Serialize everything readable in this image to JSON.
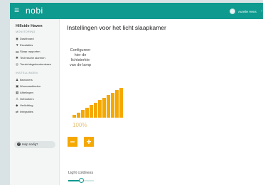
{
  "topbar": {
    "menu_icon": "hamburger-icon",
    "logo": "nobi",
    "user_name": "Aurelie Hens",
    "user_icon": "avatar-icon",
    "caret_icon": "chevron-down-icon",
    "color": "#0f9a8f"
  },
  "sidebar": {
    "org_name": "Hillside Haven",
    "monitoring_title": "MONITORING",
    "monitoring_items": [
      {
        "label": "Dashboard",
        "icon": "dashboard-icon"
      },
      {
        "label": "Escalaties",
        "icon": "alert-icon"
      },
      {
        "label": "Slaap rapporten",
        "icon": "bed-icon"
      },
      {
        "label": "Technische alarmen",
        "icon": "tools-icon"
      },
      {
        "label": "Toezichtsgebeurtenissen",
        "icon": "eye-icon"
      }
    ],
    "settings_title": "INSTELLINGEN",
    "settings_items": [
      {
        "label": "Bewoners",
        "icon": "people-icon"
      },
      {
        "label": "Woonaanbieden",
        "icon": "home-icon"
      },
      {
        "label": "Afdelingen",
        "icon": "grid-icon"
      },
      {
        "label": "Gebruikers",
        "icon": "users-icon"
      },
      {
        "label": "Verlichting",
        "icon": "bulb-icon"
      },
      {
        "label": "Integraties",
        "icon": "plug-icon"
      }
    ],
    "help_label": "Hulp nodig?"
  },
  "main": {
    "title": "Instellingen voor het licht slaapkamer",
    "configure_text": "Configureer hier de lichtsterkte van de lamp",
    "brightness_percent": "100%",
    "brightness_level": 12,
    "brightness_max": 12,
    "decrease_label": "−",
    "increase_label": "+",
    "accent_color": "#f5a800",
    "light_coldness_label": "Light coldness",
    "light_coldness_value": 0.5
  }
}
